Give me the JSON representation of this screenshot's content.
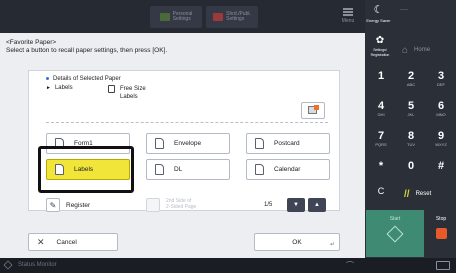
{
  "topbar": {
    "personal_label": "Personal\nSettings",
    "shared_label": "Shrd./Publ.\nSettings",
    "menu_label": "Menu"
  },
  "header": {
    "title": "<Favorite Paper>",
    "instruction": "Select a button to recall paper settings, then press [OK]."
  },
  "details": {
    "heading": "Details of Selected Paper",
    "type": "Labels",
    "size": "Free Size",
    "size_type": "Labels"
  },
  "paper_buttons": [
    {
      "label": "Form1"
    },
    {
      "label": "Envelope"
    },
    {
      "label": "Postcard"
    },
    {
      "label": "Labels"
    },
    {
      "label": "DL"
    },
    {
      "label": "Calendar"
    }
  ],
  "register_label": "Register",
  "second_side_label": "2nd Side of\n2-Sided Page",
  "page_indicator": "1/5",
  "cancel_label": "Cancel",
  "ok_label": "OK",
  "status_monitor_label": "Status Monitor",
  "right_panel": {
    "energy_saver_label": "Energy Saver",
    "dashes": "-----",
    "settings_label": "Settings/\nRegistration",
    "home_label": "Home",
    "keys": [
      {
        "num": "1",
        "sub": ""
      },
      {
        "num": "2",
        "sub": "ABC"
      },
      {
        "num": "3",
        "sub": "DEF"
      },
      {
        "num": "4",
        "sub": "GHI"
      },
      {
        "num": "5",
        "sub": "JKL"
      },
      {
        "num": "6",
        "sub": "MNO"
      },
      {
        "num": "7",
        "sub": "PQRS"
      },
      {
        "num": "8",
        "sub": "TUV"
      },
      {
        "num": "9",
        "sub": "WXYZ"
      },
      {
        "num": "*",
        "sub": ""
      },
      {
        "num": "0",
        "sub": ""
      },
      {
        "num": "#",
        "sub": ""
      }
    ],
    "clear_label": "C",
    "reset_label": "Reset",
    "start_label": "Start",
    "stop_label": "Stop"
  },
  "colors": {
    "selected_yellow": "#f1e53a",
    "start_green": "#3f8a72",
    "stop_orange": "#e85a2a",
    "reset_icon": "#d6d33a"
  }
}
